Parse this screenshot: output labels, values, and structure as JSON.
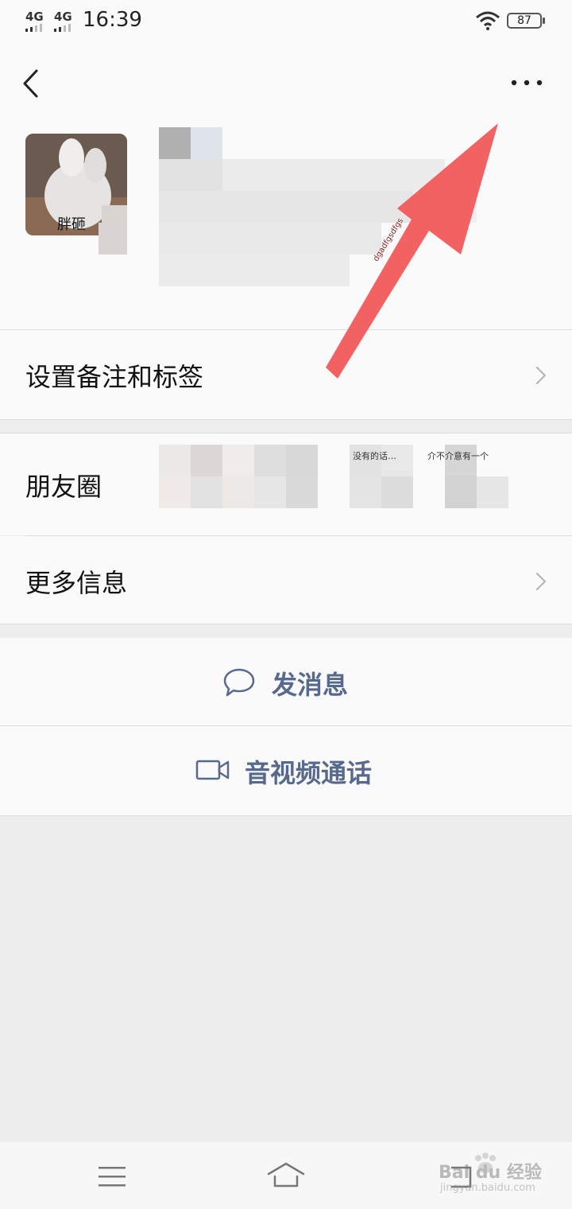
{
  "status_bar": {
    "signal1": "4G",
    "signal2": "4G",
    "time": "16:39",
    "battery": "87"
  },
  "header": {
    "back_icon": "chevron-left-icon",
    "more_icon": "ellipsis-icon"
  },
  "profile": {
    "avatar_text": "胖砸"
  },
  "rows": {
    "remark_label": "设置备注和标签",
    "moments_label": "朋友圈",
    "moments_preview": [
      "没有的话…",
      "介不介意有一个"
    ],
    "more_info_label": "更多信息"
  },
  "actions": {
    "message_label": "发消息",
    "call_label": "音视频通话"
  },
  "annotation": {
    "arrow_text": "dgadfgsdfgs",
    "arrow_color": "#f25a5a"
  },
  "watermark": {
    "text": "Bai du 经验",
    "url": "jingyan.baidu.com"
  },
  "colors": {
    "accent": "#57698c",
    "background": "#ededed",
    "card": "#fafafa"
  }
}
